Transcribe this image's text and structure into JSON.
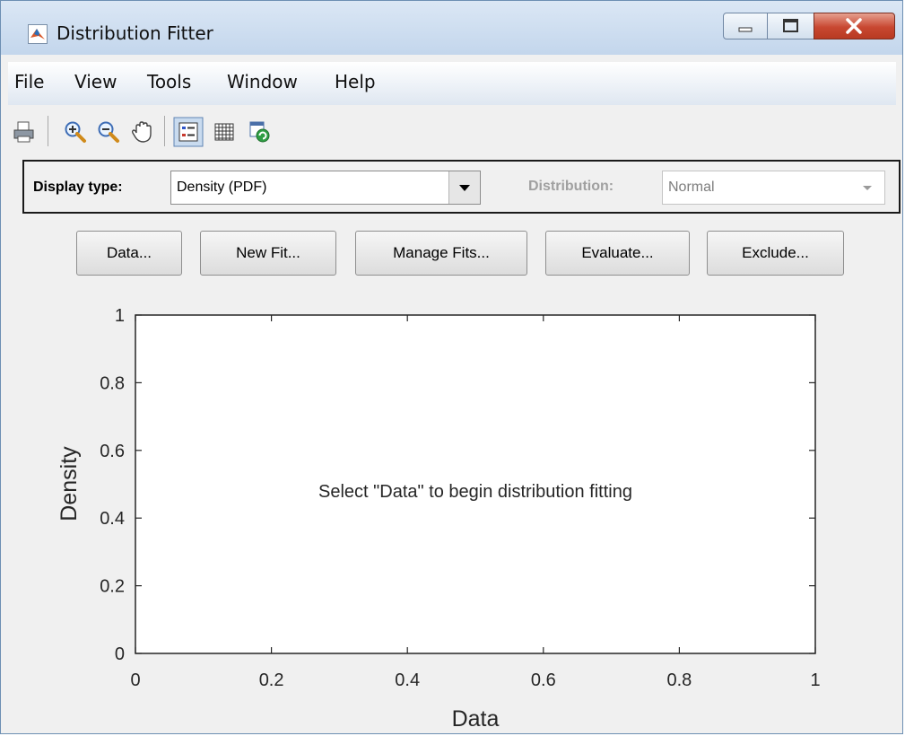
{
  "window": {
    "title": "Distribution Fitter",
    "controls": [
      "minimize",
      "maximize",
      "close"
    ]
  },
  "menu": {
    "items": [
      "File",
      "View",
      "Tools",
      "Window",
      "Help"
    ]
  },
  "toolbar": {
    "icons": [
      "print-icon",
      "zoom-in-icon",
      "zoom-out-icon",
      "pan-hand-icon",
      "legend-toggle-icon",
      "grid-toggle-icon",
      "restore-view-icon"
    ]
  },
  "display": {
    "label": "Display type:",
    "selected": "Density (PDF)",
    "distribution_label": "Distribution:",
    "distribution_selected": "Normal"
  },
  "buttons": {
    "data": "Data...",
    "new_fit": "New Fit...",
    "manage_fits": "Manage Fits...",
    "evaluate": "Evaluate...",
    "exclude": "Exclude..."
  },
  "chart_data": {
    "type": "line",
    "series": [],
    "xlabel": "Data",
    "ylabel": "Density",
    "xlim": [
      0,
      1
    ],
    "ylim": [
      0,
      1
    ],
    "xticks": [
      "0",
      "0.2",
      "0.4",
      "0.6",
      "0.8",
      "1"
    ],
    "yticks": [
      "0",
      "0.2",
      "0.4",
      "0.6",
      "0.8",
      "1"
    ],
    "annotation": "Select \"Data\" to begin distribution fitting",
    "grid": false
  }
}
